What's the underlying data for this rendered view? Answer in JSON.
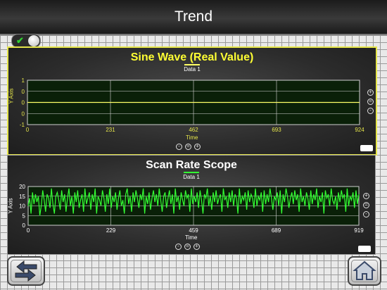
{
  "header": {
    "title": "Trend"
  },
  "toggle": {
    "check_glyph": "✔",
    "state": "on"
  },
  "sine_panel": {
    "title": "Sine Wave (Real Value)",
    "legend": "Data 1",
    "ylabel": "Y Axis",
    "xlabel": "Time",
    "title_color": "#ffff33",
    "trace_color": "#ffff66"
  },
  "scan_panel": {
    "title": "Scan Rate Scope",
    "legend": "Data 1",
    "ylabel": "Y Axis",
    "xlabel": "Time",
    "title_color": "#ffffff",
    "trace_color": "#33ff33"
  },
  "nav": {
    "switch_icon": "switch-arrows-icon",
    "home_icon": "home-icon"
  },
  "chart_data": [
    {
      "type": "line",
      "title": "Sine Wave (Real Value)",
      "xlabel": "Time",
      "ylabel": "Y Axis",
      "xlim": [
        0,
        924
      ],
      "ylim": [
        -1,
        1
      ],
      "x_ticks": [
        "0",
        "231",
        "462",
        "693",
        "924"
      ],
      "y_ticks": [
        "1",
        "0",
        "0",
        "0",
        "-1"
      ],
      "grid": true,
      "series": [
        {
          "name": "Data 1",
          "x": [
            0,
            924
          ],
          "values": [
            0,
            0
          ]
        }
      ]
    },
    {
      "type": "line",
      "title": "Scan Rate Scope",
      "xlabel": "Time",
      "ylabel": "Y Axis",
      "xlim": [
        0,
        919
      ],
      "ylim": [
        0,
        20
      ],
      "x_ticks": [
        "0",
        "229",
        "459",
        "689",
        "919"
      ],
      "y_ticks": [
        "20",
        "15",
        "10",
        "5",
        "0"
      ],
      "grid": true,
      "series": [
        {
          "name": "Data 1",
          "values": [
            10,
            14,
            6,
            17,
            11,
            16,
            12,
            15,
            5,
            10,
            18,
            13,
            7,
            16,
            14,
            9,
            19,
            11,
            6,
            15,
            17,
            13,
            8,
            18,
            12,
            16,
            7,
            14,
            19,
            10,
            15,
            6,
            17,
            12,
            18,
            9,
            13,
            16,
            7,
            19,
            11,
            14,
            17,
            8,
            16,
            12,
            19,
            6,
            15,
            13,
            10,
            18,
            14,
            7,
            16,
            11,
            19,
            9,
            15,
            12,
            17,
            8,
            14,
            18,
            10,
            13,
            6,
            16,
            19,
            11,
            15,
            7,
            17,
            12,
            18,
            14,
            9,
            16,
            13,
            19,
            6,
            15,
            11,
            17,
            8,
            14,
            18,
            12,
            16,
            10,
            19,
            13,
            7,
            15,
            17,
            9,
            14,
            18,
            11,
            16,
            6,
            19,
            12,
            15,
            8,
            17,
            13,
            10,
            18,
            14,
            16,
            7,
            19,
            11,
            15,
            12,
            17,
            9,
            18,
            13,
            6,
            16,
            14,
            19,
            10,
            15,
            8,
            17,
            12,
            18,
            11,
            14,
            16,
            7,
            19,
            13,
            15,
            9,
            17,
            12,
            18,
            10,
            16,
            14,
            6,
            19,
            11,
            15,
            13,
            17,
            8,
            18,
            12,
            16,
            14,
            9,
            19,
            10,
            15,
            13,
            17,
            7,
            18,
            11,
            16,
            12,
            19,
            14,
            8,
            15,
            13,
            17,
            10,
            18,
            6,
            16,
            12,
            19,
            15,
            9,
            14,
            17,
            11,
            18,
            13,
            16,
            7,
            19,
            12,
            15,
            10,
            17,
            14,
            8,
            18,
            11,
            16,
            13,
            19,
            9,
            15,
            12,
            17,
            6,
            18,
            14,
            16,
            10,
            19,
            13,
            11,
            15,
            8,
            17,
            12,
            18,
            14,
            16,
            7,
            19,
            10,
            15,
            13,
            17,
            9,
            18,
            11,
            16
          ]
        }
      ]
    }
  ]
}
